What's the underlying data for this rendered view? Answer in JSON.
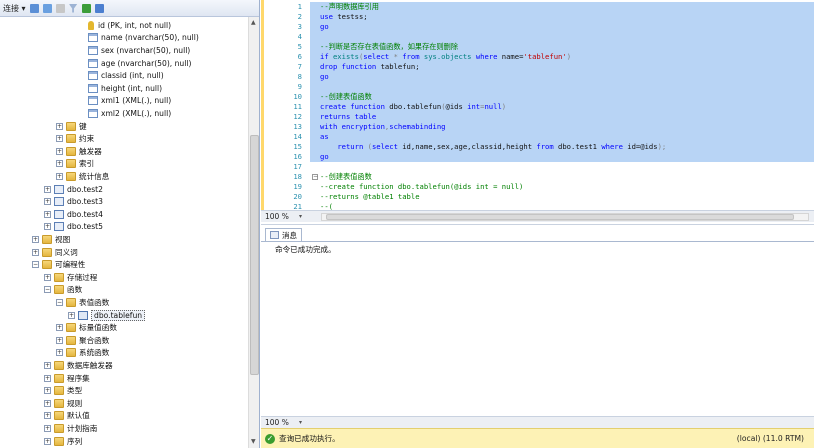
{
  "toolbar": {
    "connect_label": "连接 ▾"
  },
  "tree": [
    {
      "label": "id (PK, int, not null)",
      "icon": "key",
      "indent": 88,
      "expander": ""
    },
    {
      "label": "name (nvarchar(50), null)",
      "icon": "col",
      "indent": 88,
      "expander": ""
    },
    {
      "label": "sex (nvarchar(50), null)",
      "icon": "col",
      "indent": 88,
      "expander": ""
    },
    {
      "label": "age (nvarchar(50), null)",
      "icon": "col",
      "indent": 88,
      "expander": ""
    },
    {
      "label": "classid (int, null)",
      "icon": "col",
      "indent": 88,
      "expander": ""
    },
    {
      "label": "height (int, null)",
      "icon": "col",
      "indent": 88,
      "expander": ""
    },
    {
      "label": "xml1 (XML(.), null)",
      "icon": "col",
      "indent": 88,
      "expander": ""
    },
    {
      "label": "xml2 (XML(.), null)",
      "icon": "col",
      "indent": 88,
      "expander": ""
    },
    {
      "label": "键",
      "icon": "folder",
      "indent": 66,
      "expander": "+"
    },
    {
      "label": "约束",
      "icon": "folder",
      "indent": 66,
      "expander": "+"
    },
    {
      "label": "触发器",
      "icon": "folder",
      "indent": 66,
      "expander": "+"
    },
    {
      "label": "索引",
      "icon": "folder",
      "indent": 66,
      "expander": "+"
    },
    {
      "label": "统计信息",
      "icon": "folder",
      "indent": 66,
      "expander": "+"
    },
    {
      "label": "dbo.test2",
      "icon": "table",
      "indent": 54,
      "expander": "+"
    },
    {
      "label": "dbo.test3",
      "icon": "table",
      "indent": 54,
      "expander": "+"
    },
    {
      "label": "dbo.test4",
      "icon": "table",
      "indent": 54,
      "expander": "+"
    },
    {
      "label": "dbo.test5",
      "icon": "table",
      "indent": 54,
      "expander": "+"
    },
    {
      "label": "视图",
      "icon": "folder",
      "indent": 42,
      "expander": "+"
    },
    {
      "label": "同义词",
      "icon": "folder",
      "indent": 42,
      "expander": "+"
    },
    {
      "label": "可编程性",
      "icon": "folder",
      "indent": 42,
      "expander": "−"
    },
    {
      "label": "存储过程",
      "icon": "folder",
      "indent": 54,
      "expander": "+"
    },
    {
      "label": "函数",
      "icon": "folder",
      "indent": 54,
      "expander": "−"
    },
    {
      "label": "表值函数",
      "icon": "folder",
      "indent": 66,
      "expander": "−"
    },
    {
      "label": "dbo.tablefun",
      "icon": "func",
      "indent": 78,
      "expander": "+",
      "selected": true
    },
    {
      "label": "标量值函数",
      "icon": "folder",
      "indent": 66,
      "expander": "+"
    },
    {
      "label": "聚合函数",
      "icon": "folder",
      "indent": 66,
      "expander": "+"
    },
    {
      "label": "系统函数",
      "icon": "folder",
      "indent": 66,
      "expander": "+"
    },
    {
      "label": "数据库触发器",
      "icon": "folder",
      "indent": 54,
      "expander": "+"
    },
    {
      "label": "程序集",
      "icon": "folder",
      "indent": 54,
      "expander": "+"
    },
    {
      "label": "类型",
      "icon": "folder",
      "indent": 54,
      "expander": "+"
    },
    {
      "label": "规则",
      "icon": "folder",
      "indent": 54,
      "expander": "+"
    },
    {
      "label": "默认值",
      "icon": "folder",
      "indent": 54,
      "expander": "+"
    },
    {
      "label": "计划指南",
      "icon": "folder",
      "indent": 54,
      "expander": "+"
    },
    {
      "label": "序列",
      "icon": "folder",
      "indent": 54,
      "expander": "+"
    }
  ],
  "editor": {
    "lines": [
      {
        "n": "1",
        "sel": true,
        "fold": "",
        "tokens": [
          [
            "comment",
            "--声明数据库引用"
          ]
        ]
      },
      {
        "n": "2",
        "sel": true,
        "fold": "",
        "tokens": [
          [
            "kw",
            "use "
          ],
          [
            "black",
            "testss;"
          ]
        ]
      },
      {
        "n": "3",
        "sel": true,
        "fold": "",
        "tokens": [
          [
            "kw",
            "go"
          ]
        ]
      },
      {
        "n": "4",
        "sel": true,
        "fold": "",
        "tokens": []
      },
      {
        "n": "5",
        "sel": true,
        "fold": "",
        "tokens": [
          [
            "comment",
            "--判断是否存在表值函数，如果存在则删除"
          ]
        ]
      },
      {
        "n": "6",
        "sel": true,
        "fold": "−",
        "tokens": [
          [
            "kw",
            "if "
          ],
          [
            "obj",
            "exists"
          ],
          [
            "gray",
            "("
          ],
          [
            "kw",
            "select "
          ],
          [
            "gray",
            "* "
          ],
          [
            "kw",
            "from "
          ],
          [
            "obj",
            "sys.objects "
          ],
          [
            "kw",
            "where "
          ],
          [
            "black",
            "name="
          ],
          [
            "str",
            "'tablefun'"
          ],
          [
            "gray",
            ")"
          ]
        ]
      },
      {
        "n": "7",
        "sel": true,
        "fold": "",
        "tokens": [
          [
            "kw",
            "drop function "
          ],
          [
            "black",
            "tablefun;"
          ]
        ]
      },
      {
        "n": "8",
        "sel": true,
        "fold": "",
        "tokens": [
          [
            "kw",
            "go"
          ]
        ]
      },
      {
        "n": "9",
        "sel": true,
        "fold": "",
        "tokens": []
      },
      {
        "n": "10",
        "sel": true,
        "fold": "",
        "tokens": [
          [
            "comment",
            "--创建表值函数"
          ]
        ]
      },
      {
        "n": "11",
        "sel": true,
        "fold": "−",
        "tokens": [
          [
            "kw",
            "create function "
          ],
          [
            "black",
            "dbo.tablefun"
          ],
          [
            "gray",
            "("
          ],
          [
            "black",
            "@ids "
          ],
          [
            "kw",
            "int"
          ],
          [
            "gray",
            "="
          ],
          [
            "kw",
            "null"
          ],
          [
            "gray",
            ")"
          ]
        ]
      },
      {
        "n": "12",
        "sel": true,
        "fold": "",
        "tokens": [
          [
            "kw",
            "returns table"
          ]
        ]
      },
      {
        "n": "13",
        "sel": true,
        "fold": "",
        "tokens": [
          [
            "kw",
            "with encryption"
          ],
          [
            "gray",
            ","
          ],
          [
            "kw",
            "schemabinding"
          ]
        ]
      },
      {
        "n": "14",
        "sel": true,
        "fold": "",
        "tokens": [
          [
            "kw",
            "as"
          ]
        ]
      },
      {
        "n": "15",
        "sel": true,
        "fold": "",
        "tokens": [
          [
            "black",
            "    "
          ],
          [
            "kw",
            "return "
          ],
          [
            "gray",
            "("
          ],
          [
            "kw",
            "select "
          ],
          [
            "black",
            "id,name,sex,age,classid,height "
          ],
          [
            "kw",
            "from "
          ],
          [
            "black",
            "dbo.test1 "
          ],
          [
            "kw",
            "where "
          ],
          [
            "black",
            "id=@ids"
          ],
          [
            "gray",
            ");"
          ]
        ]
      },
      {
        "n": "16",
        "sel": true,
        "fold": "",
        "tokens": [
          [
            "kw",
            "go"
          ]
        ]
      },
      {
        "n": "17",
        "sel": false,
        "fold": "",
        "tokens": []
      },
      {
        "n": "18",
        "sel": false,
        "fold": "−",
        "tokens": [
          [
            "comment",
            "--创建表值函数"
          ]
        ]
      },
      {
        "n": "19",
        "sel": false,
        "fold": "",
        "tokens": [
          [
            "comment",
            "--create function dbo.tablefun(@ids int = null)"
          ]
        ]
      },
      {
        "n": "20",
        "sel": false,
        "fold": "",
        "tokens": [
          [
            "comment",
            "--returns @table1 table"
          ]
        ]
      },
      {
        "n": "21",
        "sel": false,
        "fold": "",
        "tokens": [
          [
            "comment",
            "--("
          ]
        ]
      }
    ],
    "zoom_top": "100 %",
    "zoom_bottom": "100 %"
  },
  "results": {
    "tab_label": "消息",
    "message": "命令已成功完成。"
  },
  "status": {
    "text": "查询已成功执行。",
    "server": "(local) (11.0 RTM)"
  }
}
